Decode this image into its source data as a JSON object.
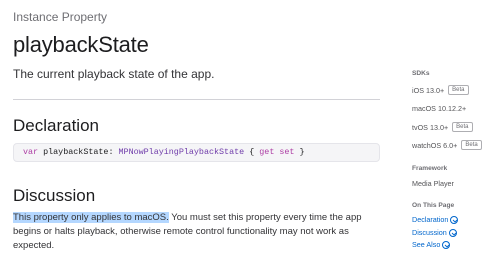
{
  "page": {
    "eyebrow": "Instance Property",
    "title": "playbackState",
    "abstract": "The current playback state of the app."
  },
  "declaration": {
    "heading": "Declaration",
    "code": {
      "kw_var": "var",
      "name": "playbackState",
      "colon": ":",
      "type": "MPNowPlayingPlaybackState",
      "brace_open": "{",
      "kw_get": "get",
      "kw_set": "set",
      "brace_close": "}"
    }
  },
  "discussion": {
    "heading": "Discussion",
    "highlighted": "This property only applies to macOS.",
    "rest": " You must set this property every time the app begins or halts playback, otherwise remote control functionality may not work as expected."
  },
  "sidebar": {
    "sdks_heading": "SDKs",
    "sdks": [
      {
        "name": "iOS 13.0+",
        "badge": "Beta"
      },
      {
        "name": "macOS 10.12.2+",
        "badge": ""
      },
      {
        "name": "tvOS 13.0+",
        "badge": "Beta"
      },
      {
        "name": "watchOS 6.0+",
        "badge": "Beta"
      }
    ],
    "framework_heading": "Framework",
    "framework": "Media Player",
    "on_this_page_heading": "On This Page",
    "links": [
      {
        "label": "Declaration",
        "icon": "chevron-circle-down-icon"
      },
      {
        "label": "Discussion",
        "icon": "chevron-circle-down-icon"
      },
      {
        "label": "See Also",
        "icon": "chevron-circle-down-icon"
      }
    ]
  },
  "colors": {
    "link": "#0066cc",
    "keyword": "#ad3da4",
    "type": "#703daa",
    "highlight": "#b4d7ff"
  }
}
